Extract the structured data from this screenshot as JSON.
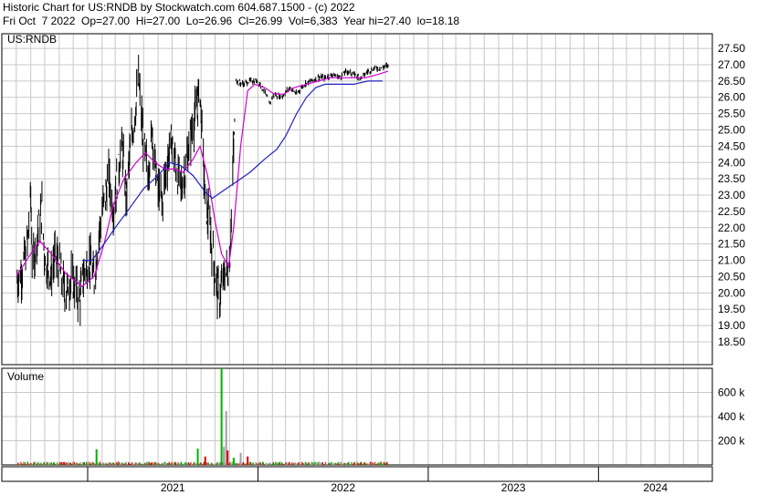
{
  "header": {
    "line1": "Historic Chart for US:RNDB by Stockwatch.com 604.687.1500 - (c) 2022",
    "line2": "Fri Oct  7 2022  Op=27.00  Hi=27.00  Lo=26.96  Cl=26.99  Vol=6,383  Year hi=27.40  lo=18.18"
  },
  "chart_data": [
    {
      "type": "line",
      "subtype": "price-bar",
      "symbol_label": "US:RNDB",
      "ylim": [
        17.8,
        27.95
      ],
      "y_ticks": [
        "27.50",
        "27.00",
        "26.50",
        "26.00",
        "25.50",
        "25.00",
        "24.50",
        "24.00",
        "23.50",
        "23.00",
        "22.50",
        "22.00",
        "21.50",
        "21.00",
        "20.50",
        "20.00",
        "19.50",
        "19.00",
        "18.50"
      ],
      "x_ticks": [
        "2021",
        "2022",
        "2023",
        "2024"
      ],
      "grid": true,
      "colors": {
        "price": "#000000",
        "ma_fast": "#d000d0",
        "ma_slow": "#2020c0",
        "grid": "#c8c8c8"
      },
      "series": [
        {
          "role": "price-close-approx",
          "points": [
            [
              "2020-08-01",
              20.3
            ],
            [
              "2020-08-15",
              20.8
            ],
            [
              "2020-08-25",
              21.5
            ],
            [
              "2020-09-01",
              23.0
            ],
            [
              "2020-09-05",
              20.6
            ],
            [
              "2020-09-15",
              21.8
            ],
            [
              "2020-09-25",
              22.6
            ],
            [
              "2020-10-01",
              21.0
            ],
            [
              "2020-10-15",
              20.6
            ],
            [
              "2020-10-25",
              21.2
            ],
            [
              "2020-11-05",
              20.5
            ],
            [
              "2020-11-15",
              20.0
            ],
            [
              "2020-11-25",
              20.4
            ],
            [
              "2020-12-05",
              20.2
            ],
            [
              "2020-12-15",
              19.8
            ],
            [
              "2020-12-25",
              20.7
            ],
            [
              "2021-01-05",
              21.0
            ],
            [
              "2021-01-15",
              20.4
            ],
            [
              "2021-01-25",
              21.8
            ],
            [
              "2021-02-05",
              22.8
            ],
            [
              "2021-02-15",
              23.5
            ],
            [
              "2021-02-25",
              22.6
            ],
            [
              "2021-03-05",
              23.5
            ],
            [
              "2021-03-15",
              24.5
            ],
            [
              "2021-03-25",
              23.0
            ],
            [
              "2021-04-05",
              24.8
            ],
            [
              "2021-04-15",
              25.8
            ],
            [
              "2021-04-20",
              26.6
            ],
            [
              "2021-05-01",
              24.5
            ],
            [
              "2021-05-10",
              23.6
            ],
            [
              "2021-05-20",
              25.0
            ],
            [
              "2021-05-30",
              23.2
            ],
            [
              "2021-06-10",
              22.8
            ],
            [
              "2021-06-20",
              24.0
            ],
            [
              "2021-06-30",
              24.7
            ],
            [
              "2021-07-10",
              23.8
            ],
            [
              "2021-07-20",
              23.2
            ],
            [
              "2021-07-30",
              23.8
            ],
            [
              "2021-08-10",
              24.8
            ],
            [
              "2021-08-20",
              25.5
            ],
            [
              "2021-08-30",
              26.2
            ],
            [
              "2021-09-10",
              22.8
            ],
            [
              "2021-09-20",
              22.0
            ],
            [
              "2021-10-01",
              20.5
            ],
            [
              "2021-10-10",
              19.8
            ],
            [
              "2021-10-20",
              20.5
            ],
            [
              "2021-11-01",
              20.8
            ],
            [
              "2021-11-15",
              26.5
            ],
            [
              "2021-12-01",
              26.4
            ],
            [
              "2021-12-15",
              26.5
            ],
            [
              "2022-01-01",
              26.5
            ],
            [
              "2022-01-15",
              26.2
            ],
            [
              "2022-01-25",
              25.8
            ],
            [
              "2022-02-05",
              26.1
            ],
            [
              "2022-02-20",
              26.0
            ],
            [
              "2022-03-10",
              26.3
            ],
            [
              "2022-03-25",
              26.1
            ],
            [
              "2022-04-10",
              26.4
            ],
            [
              "2022-04-25",
              26.5
            ],
            [
              "2022-05-10",
              26.6
            ],
            [
              "2022-05-25",
              26.6
            ],
            [
              "2022-06-10",
              26.7
            ],
            [
              "2022-06-25",
              26.6
            ],
            [
              "2022-07-10",
              26.8
            ],
            [
              "2022-07-25",
              26.7
            ],
            [
              "2022-08-10",
              26.6
            ],
            [
              "2022-08-25",
              26.8
            ],
            [
              "2022-09-10",
              26.9
            ],
            [
              "2022-09-25",
              26.9
            ],
            [
              "2022-10-07",
              26.99
            ]
          ]
        },
        {
          "role": "moving-average-fast",
          "points": [
            [
              "2020-08-01",
              20.5
            ],
            [
              "2020-09-01",
              21.2
            ],
            [
              "2020-09-20",
              21.6
            ],
            [
              "2020-10-15",
              21.2
            ],
            [
              "2020-11-15",
              20.6
            ],
            [
              "2020-12-20",
              20.2
            ],
            [
              "2021-01-15",
              20.5
            ],
            [
              "2021-02-05",
              21.5
            ],
            [
              "2021-02-25",
              22.7
            ],
            [
              "2021-03-20",
              23.5
            ],
            [
              "2021-04-15",
              24.0
            ],
            [
              "2021-05-05",
              24.3
            ],
            [
              "2021-05-25",
              24.0
            ],
            [
              "2021-06-15",
              23.8
            ],
            [
              "2021-07-05",
              23.8
            ],
            [
              "2021-07-25",
              23.7
            ],
            [
              "2021-08-15",
              24.1
            ],
            [
              "2021-08-30",
              24.5
            ],
            [
              "2021-09-15",
              23.6
            ],
            [
              "2021-10-01",
              22.2
            ],
            [
              "2021-10-15",
              21.2
            ],
            [
              "2021-10-30",
              20.8
            ],
            [
              "2021-11-10",
              22.0
            ],
            [
              "2021-11-25",
              24.5
            ],
            [
              "2021-12-10",
              26.2
            ],
            [
              "2021-12-25",
              26.4
            ],
            [
              "2022-01-15",
              26.3
            ],
            [
              "2022-02-05",
              26.1
            ],
            [
              "2022-02-25",
              26.1
            ],
            [
              "2022-03-20",
              26.3
            ],
            [
              "2022-04-15",
              26.4
            ],
            [
              "2022-05-10",
              26.5
            ],
            [
              "2022-06-05",
              26.6
            ],
            [
              "2022-07-01",
              26.6
            ],
            [
              "2022-07-25",
              26.6
            ],
            [
              "2022-08-20",
              26.6
            ],
            [
              "2022-09-15",
              26.7
            ],
            [
              "2022-10-07",
              26.8
            ]
          ]
        },
        {
          "role": "moving-average-slow",
          "points": [
            [
              "2020-12-20",
              21.0
            ],
            [
              "2021-01-10",
              21.0
            ],
            [
              "2021-02-05",
              21.5
            ],
            [
              "2021-03-01",
              22.0
            ],
            [
              "2021-04-01",
              22.6
            ],
            [
              "2021-05-01",
              23.2
            ],
            [
              "2021-06-01",
              23.6
            ],
            [
              "2021-06-25",
              24.0
            ],
            [
              "2021-07-20",
              23.9
            ],
            [
              "2021-08-15",
              23.6
            ],
            [
              "2021-09-10",
              23.1
            ],
            [
              "2021-09-25",
              22.9
            ],
            [
              "2021-10-15",
              23.1
            ],
            [
              "2021-11-15",
              23.4
            ],
            [
              "2021-12-15",
              23.7
            ],
            [
              "2022-01-15",
              24.1
            ],
            [
              "2022-02-10",
              24.4
            ],
            [
              "2022-03-01",
              24.8
            ],
            [
              "2022-03-25",
              25.5
            ],
            [
              "2022-04-15",
              26.0
            ],
            [
              "2022-05-05",
              26.3
            ],
            [
              "2022-05-25",
              26.4
            ],
            [
              "2022-06-25",
              26.4
            ],
            [
              "2022-07-25",
              26.4
            ],
            [
              "2022-08-25",
              26.5
            ],
            [
              "2022-09-25",
              26.5
            ]
          ]
        }
      ]
    },
    {
      "type": "bar",
      "title": "Volume",
      "ylim": [
        0,
        800000
      ],
      "y_ticks": [
        "600 k",
        "400 k",
        "200 k"
      ],
      "colors": {
        "up": "#00b000",
        "down": "#e00000",
        "unchanged": "#a0a0a0"
      },
      "notable_bars": [
        {
          "date": "2021-01-20",
          "value": 130000,
          "direction": "up"
        },
        {
          "date": "2021-08-25",
          "value": 135000,
          "direction": "up"
        },
        {
          "date": "2021-09-10",
          "value": 70000,
          "direction": "down"
        },
        {
          "date": "2021-10-15",
          "value": 800000,
          "direction": "up"
        },
        {
          "date": "2021-10-20",
          "value": 150000,
          "direction": "unchanged"
        },
        {
          "date": "2021-10-25",
          "value": 445000,
          "direction": "unchanged"
        },
        {
          "date": "2021-10-28",
          "value": 120000,
          "direction": "down"
        },
        {
          "date": "2021-11-10",
          "value": 60000,
          "direction": "up"
        },
        {
          "date": "2021-11-25",
          "value": 100000,
          "direction": "unchanged"
        },
        {
          "date": "2021-12-10",
          "value": 70000,
          "direction": "down"
        }
      ],
      "baseline_level": 25000
    }
  ]
}
